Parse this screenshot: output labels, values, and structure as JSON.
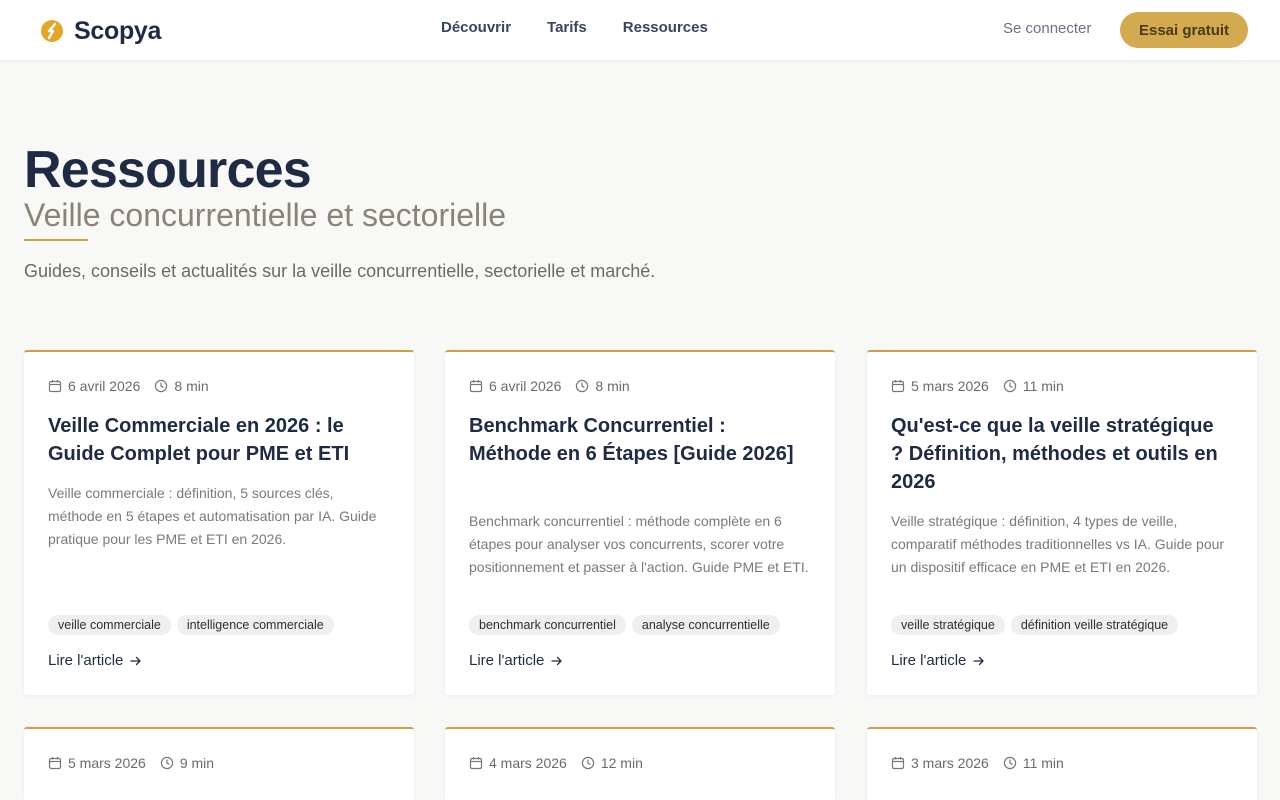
{
  "header": {
    "brand": "Scopya",
    "nav": [
      "Découvrir",
      "Tarifs",
      "Ressources"
    ],
    "signin": "Se connecter",
    "cta": "Essai gratuit",
    "accent": "#d3aa4f"
  },
  "hero": {
    "title": "Ressources",
    "subtitle": "Veille concurrentielle et sectorielle",
    "description": "Guides, conseils et actualités sur la veille concurrentielle, sectorielle et marché."
  },
  "read_label": "Lire l'article",
  "cards": [
    {
      "date": "6 avril 2026",
      "duration": "8 min",
      "title": "Veille Commerciale en 2026 : le Guide Complet pour PME et ETI",
      "description": "Veille commerciale : définition, 5 sources clés, méthode en 5 étapes et automatisation par IA. Guide pratique pour les PME et ETI en 2026.",
      "tags": [
        "veille commerciale",
        "intelligence commerciale"
      ]
    },
    {
      "date": "6 avril 2026",
      "duration": "8 min",
      "title": "Benchmark Concurrentiel : Méthode en 6 Étapes [Guide 2026]",
      "description": "Benchmark concurrentiel : méthode complète en 6 étapes pour analyser vos concurrents, scorer votre positionnement et passer à l'action. Guide PME et ETI.",
      "tags": [
        "benchmark concurrentiel",
        "analyse concurrentielle"
      ]
    },
    {
      "date": "5 mars 2026",
      "duration": "11 min",
      "title": "Qu'est-ce que la veille stratégique ? Définition, méthodes et outils en 2026",
      "description": "Veille stratégique : définition, 4 types de veille, comparatif méthodes traditionnelles vs IA. Guide pour un dispositif efficace en PME et ETI en 2026.",
      "tags": [
        "veille stratégique",
        "définition veille stratégique"
      ]
    },
    {
      "date": "5 mars 2026",
      "duration": "9 min"
    },
    {
      "date": "4 mars 2026",
      "duration": "12 min"
    },
    {
      "date": "3 mars 2026",
      "duration": "11 min"
    }
  ]
}
